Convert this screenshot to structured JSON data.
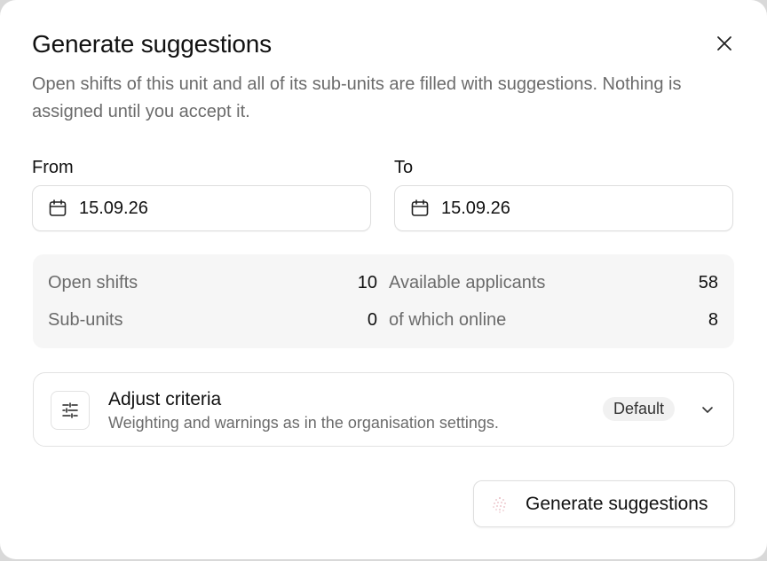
{
  "dialog": {
    "title": "Generate suggestions",
    "description": "Open shifts of this unit and all of its sub-units are filled with suggestions. Nothing is assigned until you accept it."
  },
  "icons": {
    "close": "close-icon",
    "calendar": "calendar-icon",
    "sliders": "sliders-icon",
    "chevron": "chevron-down-icon",
    "sparkle": "sparkle-icon"
  },
  "dates": {
    "from_label": "From",
    "from_value": "15.09.26",
    "to_label": "To",
    "to_value": "15.09.26"
  },
  "stats": {
    "open_shifts_label": "Open shifts",
    "open_shifts_value": "10",
    "sub_units_label": "Sub-units",
    "sub_units_value": "0",
    "available_label": "Available applicants",
    "available_value": "58",
    "online_label": "of which online",
    "online_value": "8"
  },
  "criteria": {
    "title": "Adjust criteria",
    "subtitle": "Weighting and warnings as in the organisation settings.",
    "badge": "Default"
  },
  "actions": {
    "generate_label": "Generate suggestions"
  },
  "colors": {
    "muted_text": "#6b6b6b",
    "panel_bg": "#f6f6f6",
    "border": "#dedede"
  }
}
